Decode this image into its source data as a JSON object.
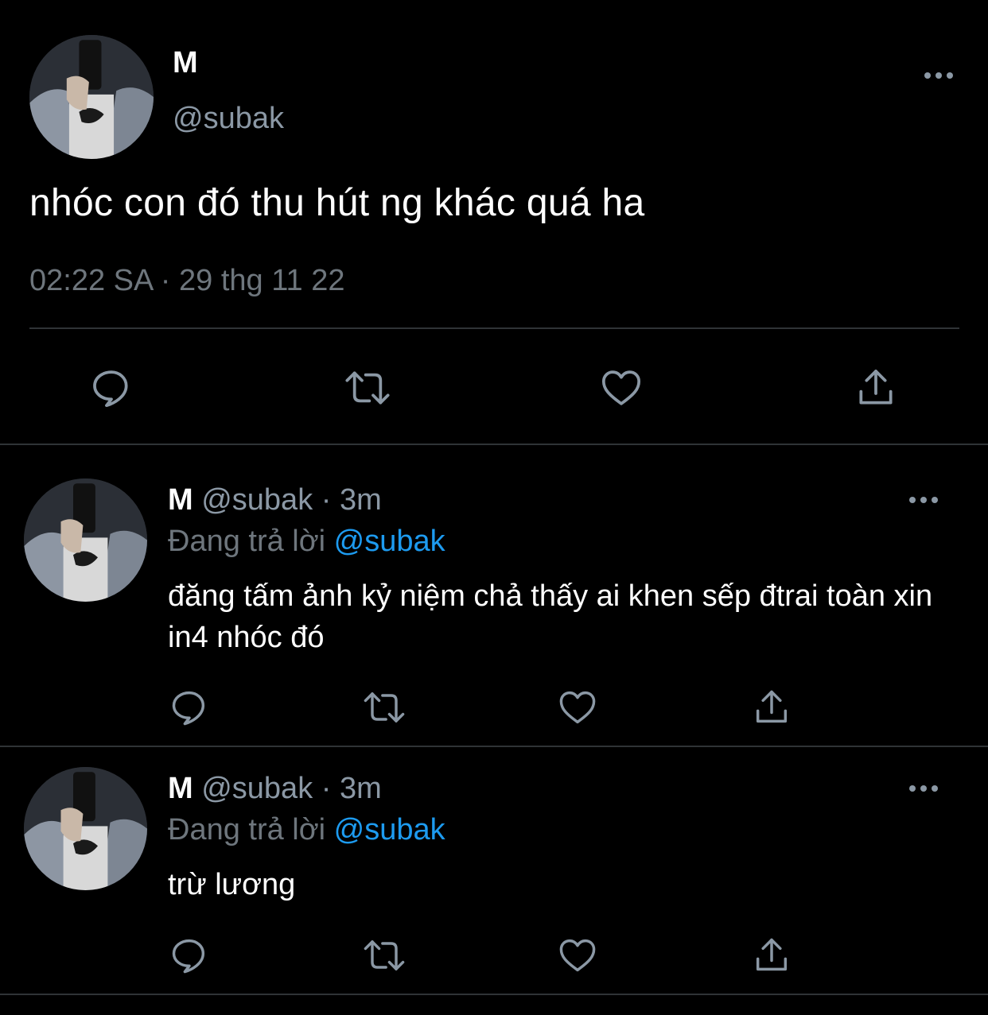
{
  "colors": {
    "background": "#000000",
    "text_primary": "#ffffff",
    "text_secondary": "#8b98a5",
    "mention": "#1d9bf0",
    "icon": "#8b98a5",
    "divider": "#2f3336"
  },
  "main_tweet": {
    "author_name": "M",
    "author_handle": "@subak",
    "text": "nhóc con đó thu hút ng khác quá ha",
    "meta": "02:22 SA · 29 thg 11 22",
    "more_icon": "more-horizontal-icon",
    "actions": [
      {
        "icon": "reply-icon"
      },
      {
        "icon": "retweet-icon"
      },
      {
        "icon": "like-icon"
      },
      {
        "icon": "share-icon"
      }
    ]
  },
  "replies": [
    {
      "author_name": "M",
      "author_handle": "@subak",
      "separator": "·",
      "time": "3m",
      "replying_prefix": "Đang trả lời",
      "replying_to": "@subak",
      "text": "đăng tấm ảnh kỷ niệm chả thấy ai khen sếp đtrai toàn xin in4 nhóc đó"
    },
    {
      "author_name": "M",
      "author_handle": "@subak",
      "separator": "·",
      "time": "3m",
      "replying_prefix": "Đang trả lời",
      "replying_to": "@subak",
      "text": "trừ lương"
    }
  ]
}
